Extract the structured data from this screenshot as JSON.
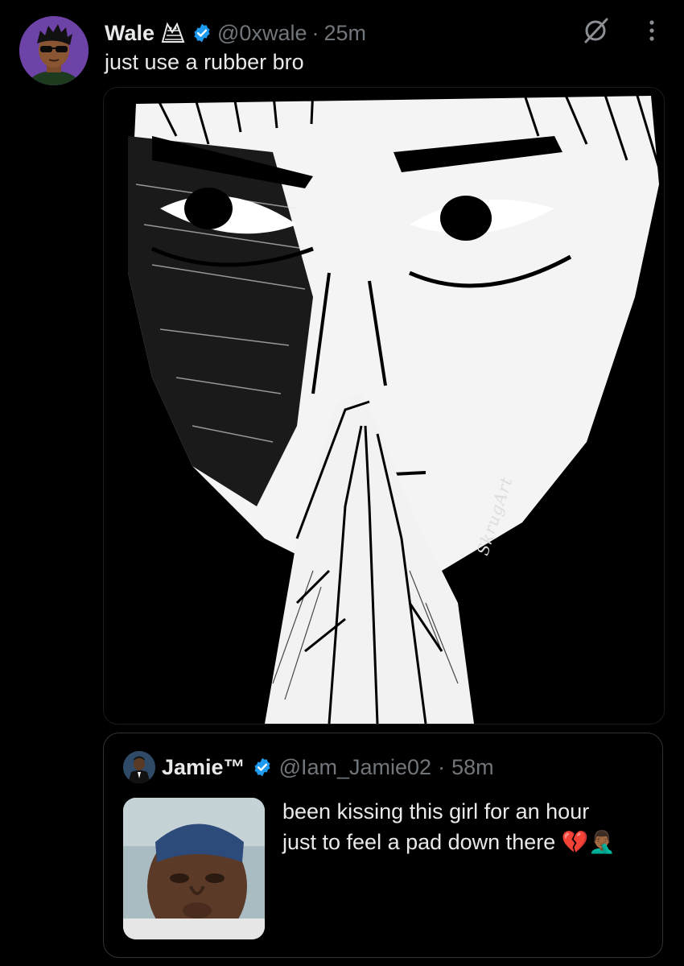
{
  "tweet": {
    "display_name": "Wale",
    "affiliation_icon": "ovo-owl-icon",
    "verified_icon": "verified-badge-icon",
    "handle": "@0xwale",
    "separator": "·",
    "time": "25m",
    "text": "just use a rubber bro",
    "media": {
      "description_icon": "manga-illustration-image",
      "signature": "SkrugArt"
    },
    "actions": {
      "grok_icon": "grok-icon",
      "more_icon": "more-options-icon"
    }
  },
  "quote": {
    "display_name": "Jamie™",
    "verified_icon": "verified-badge-icon",
    "handle": "@Iam_Jamie02",
    "separator": "·",
    "time": "58m",
    "line1": "been kissing this girl for an hour",
    "line2": "just to feel a pad down there 💔🤦🏾‍♂️",
    "media_icon": "man-photo-thumbnail"
  },
  "colors": {
    "background": "#000000",
    "text": "#e7e9ea",
    "secondary": "#71767b",
    "verified": "#1d9bf0",
    "border": "#2f3336"
  }
}
